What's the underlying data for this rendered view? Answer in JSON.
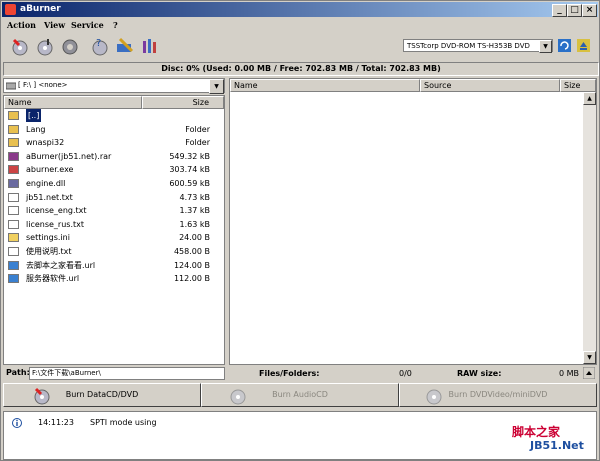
{
  "window": {
    "title": "aBurner"
  },
  "menu": {
    "items": [
      "Action",
      "View",
      "Service",
      "?"
    ]
  },
  "drive": {
    "selected": "TSSTcorp DVD-ROM TS-H353B DVD"
  },
  "disc_info": "Disc: 0% (Used: 0.00 MB / Free: 702.83 MB / Total: 702.83 MB)",
  "left": {
    "path_combo": "[ F:\\ ]  <none>",
    "headers": {
      "name": "Name",
      "size": "Size"
    },
    "files": [
      {
        "name": "[..]",
        "size": "",
        "icon": "folder-up"
      },
      {
        "name": "Lang",
        "size": "Folder",
        "icon": "folder"
      },
      {
        "name": "wnaspi32",
        "size": "Folder",
        "icon": "folder"
      },
      {
        "name": "aBurner(jb51.net).rar",
        "size": "549.32 kB",
        "icon": "rar"
      },
      {
        "name": "aburner.exe",
        "size": "303.74 kB",
        "icon": "exe"
      },
      {
        "name": "engine.dll",
        "size": "600.59 kB",
        "icon": "dll"
      },
      {
        "name": "jb51.net.txt",
        "size": "4.73 kB",
        "icon": "txt"
      },
      {
        "name": "license_eng.txt",
        "size": "1.37 kB",
        "icon": "txt"
      },
      {
        "name": "license_rus.txt",
        "size": "1.63 kB",
        "icon": "txt"
      },
      {
        "name": "settings.ini",
        "size": "24.00 B",
        "icon": "ini"
      },
      {
        "name": "使用说明.txt",
        "size": "458.00 B",
        "icon": "txt"
      },
      {
        "name": "去脚本之家看看.url",
        "size": "124.00 B",
        "icon": "url"
      },
      {
        "name": "服务器软件.url",
        "size": "112.00 B",
        "icon": "url"
      }
    ]
  },
  "right": {
    "headers": {
      "name": "Name",
      "source": "Source",
      "size": "Size"
    }
  },
  "path_row": {
    "label": "Path:",
    "value": "F:\\文件下载\\aBurner\\"
  },
  "stats": {
    "files_label": "Files/Folders:",
    "files_value": "0/0",
    "raw_label": "RAW size:",
    "raw_value": "0 MB"
  },
  "burn_buttons": {
    "data": "Burn DataCD/DVD",
    "audio": "Burn AudioCD",
    "video": "Burn DVDVideo/miniDVD"
  },
  "log": {
    "time": "14:11:23",
    "message": "SPTI mode using"
  },
  "watermark": {
    "line1": "脚本之家",
    "line2": "JB51.Net"
  }
}
